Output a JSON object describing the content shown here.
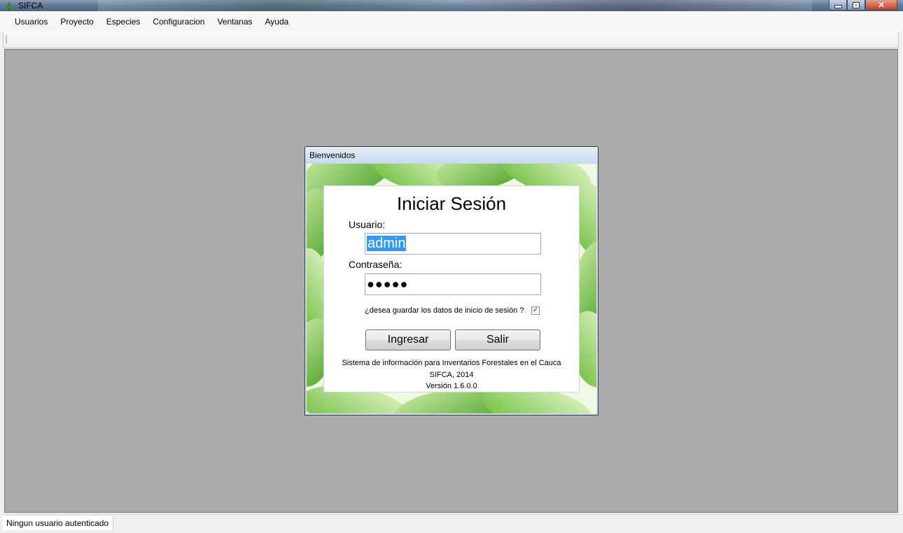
{
  "app": {
    "title": "SIFCA",
    "icon": "tree-icon"
  },
  "menu": {
    "items": [
      {
        "label": "Usuarios"
      },
      {
        "label": "Proyecto"
      },
      {
        "label": "Especies"
      },
      {
        "label": "Configuracion"
      },
      {
        "label": "Ventanas"
      },
      {
        "label": "Ayuda"
      }
    ]
  },
  "statusbar": {
    "text": "Ningun usuario autenticado"
  },
  "dialog": {
    "title": "Bienvenidos",
    "heading": "Iniciar Sesión",
    "user_label": "Usuario:",
    "user_value": "admin",
    "password_label": "Contraseña:",
    "password_mask": "●●●●●",
    "remember_label": "¿desea guardar los datos de inicio de sesión ?",
    "remember_checked": true,
    "login_button": "Ingresar",
    "exit_button": "Salir",
    "footer_line1": "Sistema de información para Inventarios Forestales en el Cauca",
    "footer_line2": "SIFCA, 2014",
    "footer_line3": "Versión 1.6.0.0"
  },
  "colors": {
    "mdi_background": "#ababab",
    "selection": "#3399ff",
    "leaf_green": "#7cc243"
  }
}
